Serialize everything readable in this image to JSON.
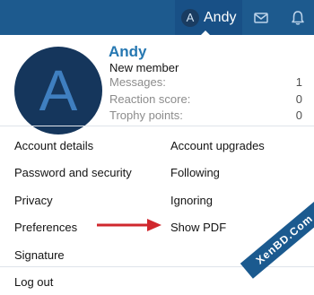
{
  "topbar": {
    "user_initial": "A",
    "user_name": "Andy",
    "inbox_icon": "inbox-icon",
    "alerts_icon": "bell-icon",
    "bar_color": "#1d5a8e"
  },
  "profile": {
    "avatar_initial": "A",
    "name": "Andy",
    "user_title": "New member",
    "stats": [
      {
        "label": "Messages:",
        "value": "1"
      },
      {
        "label": "Reaction score:",
        "value": "0"
      },
      {
        "label": "Trophy points:",
        "value": "0"
      }
    ]
  },
  "links": {
    "left": [
      "Account details",
      "Password and security",
      "Privacy",
      "Preferences",
      "Signature"
    ],
    "right": [
      "Account upgrades",
      "Following",
      "Ignoring",
      "Show PDF"
    ]
  },
  "logout_label": "Log out",
  "annotation": {
    "arrow_color": "#d0282e"
  },
  "watermark": "XenBD.Com"
}
